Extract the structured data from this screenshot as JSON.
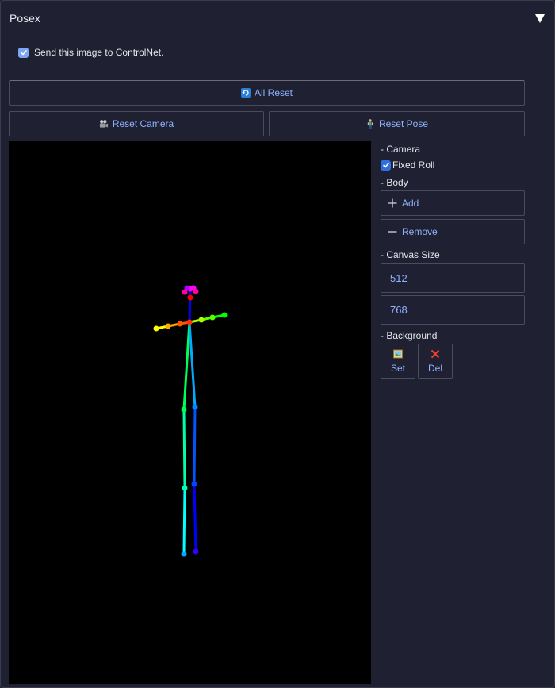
{
  "panel": {
    "title": "Posex"
  },
  "send_to_controlnet": {
    "label": "Send this image to ControlNet.",
    "checked": true
  },
  "buttons": {
    "all_reset": "All Reset",
    "reset_camera": "Reset Camera",
    "reset_pose": "Reset Pose"
  },
  "sidebar": {
    "camera_label": "- Camera",
    "fixed_roll_label": "Fixed Roll",
    "fixed_roll_checked": true,
    "body_label": "- Body",
    "add_label": "Add",
    "remove_label": "Remove",
    "canvas_size_label": "- Canvas Size",
    "canvas_width": "512",
    "canvas_height": "768",
    "background_label": "- Background",
    "set_label": "Set",
    "del_label": "Del"
  },
  "colors": {
    "accent": "#8db3ff",
    "panel_bg": "#1f2031",
    "canvas_bg": "#000000"
  },
  "icons": {
    "collapse": "triangle-down-icon",
    "all_reset": "refresh-icon",
    "reset_camera": "video-camera-icon",
    "reset_pose": "person-icon",
    "add": "plus-icon",
    "remove": "minus-icon",
    "set": "image-icon",
    "del": "cross-icon"
  }
}
